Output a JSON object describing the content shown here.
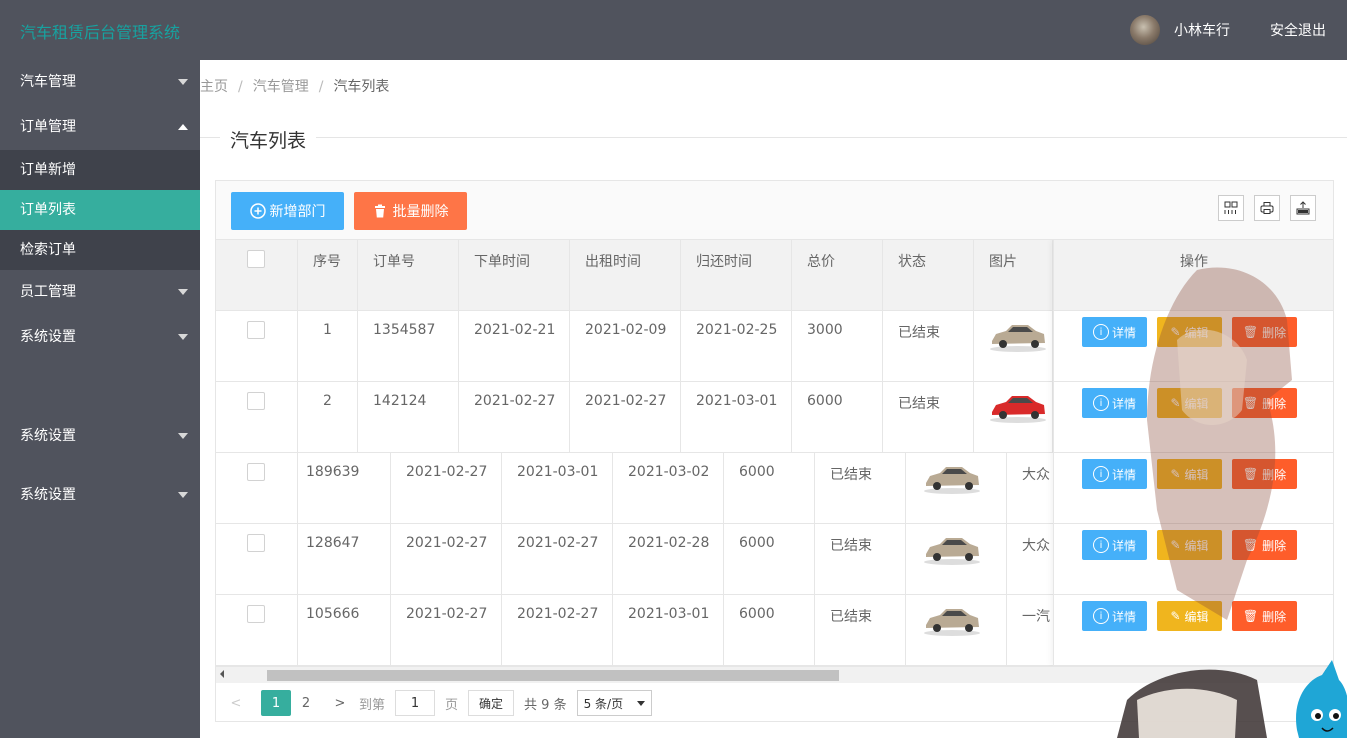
{
  "app": {
    "title": "汽车租赁后台管理系统",
    "user": "小林车行",
    "logout": "安全退出"
  },
  "sidebar": {
    "items": [
      {
        "label": "汽车管理"
      },
      {
        "label": "订单管理"
      },
      {
        "label": "订单新增"
      },
      {
        "label": "订单列表"
      },
      {
        "label": "检索订单"
      },
      {
        "label": "员工管理"
      },
      {
        "label": "系统设置"
      },
      {
        "label": "系统设置"
      },
      {
        "label": "系统设置"
      }
    ]
  },
  "breadcrumb": {
    "home": "主页",
    "sep": "/",
    "section": "汽车管理",
    "current": "汽车列表"
  },
  "page_title": "汽车列表",
  "toolbar": {
    "add_label": "新增部门",
    "batch_delete_label": "批量删除",
    "cols_icon": "columns-icon",
    "print_icon": "print-icon",
    "export_icon": "export-icon"
  },
  "table": {
    "headers": {
      "index": "序号",
      "order": "订单号",
      "order_time": "下单时间",
      "rent_time": "出租时间",
      "return_time": "归还时间",
      "price": "总价",
      "status": "状态",
      "image": "图片",
      "actions": "操作"
    },
    "rows": [
      {
        "index": "1",
        "order": "1354587",
        "order_time": "2021-02-21",
        "rent_time": "2021-02-09",
        "return_time": "2021-02-25",
        "price": "3000",
        "status": "已结束",
        "car_color": "#b9aa94"
      },
      {
        "index": "2",
        "order": "142124",
        "order_time": "2021-02-27",
        "rent_time": "2021-02-27",
        "return_time": "2021-03-01",
        "price": "6000",
        "status": "已结束",
        "car_color": "#d92a2a"
      },
      {
        "order": "189639",
        "order_time": "2021-02-27",
        "rent_time": "2021-03-01",
        "return_time": "2021-03-02",
        "price": "6000",
        "status": "已结束",
        "car_color": "#b9aa94",
        "extra": "大众"
      },
      {
        "order": "128647",
        "order_time": "2021-02-27",
        "rent_time": "2021-02-27",
        "return_time": "2021-02-28",
        "price": "6000",
        "status": "已结束",
        "car_color": "#b9aa94",
        "extra": "大众"
      },
      {
        "order": "105666",
        "order_time": "2021-02-27",
        "rent_time": "2021-02-27",
        "return_time": "2021-03-01",
        "price": "6000",
        "status": "已结束",
        "car_color": "#b9aa94",
        "extra": "一汽"
      }
    ],
    "actions": {
      "detail": "详情",
      "edit": "编辑",
      "delete": "删除"
    }
  },
  "pager": {
    "pages": [
      "1",
      "2"
    ],
    "goto": "到第",
    "page_value": "1",
    "page_unit": "页",
    "confirm": "确定",
    "total": "共 9 条",
    "per_page": "5 条/页"
  }
}
